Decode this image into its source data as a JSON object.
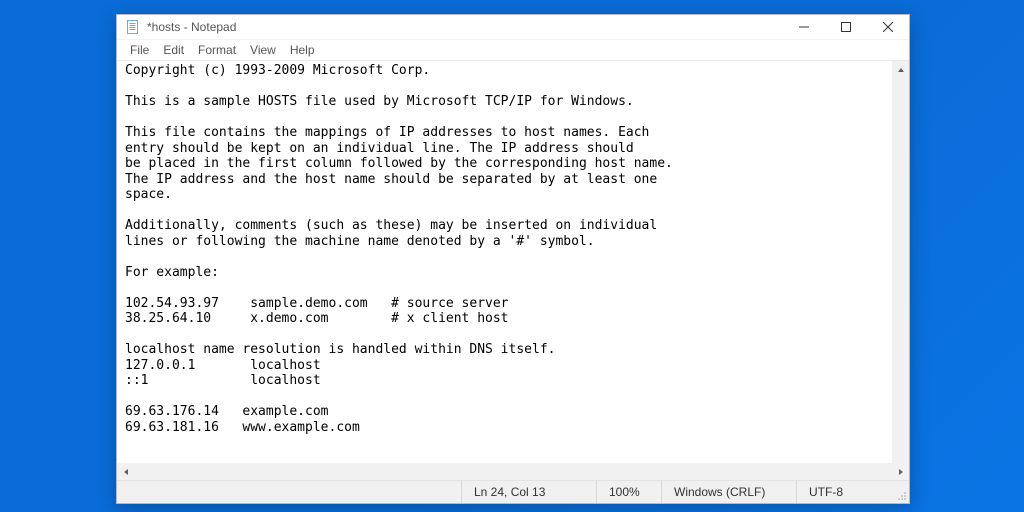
{
  "window": {
    "title": "*hosts - Notepad"
  },
  "menubar": {
    "items": [
      "File",
      "Edit",
      "Format",
      "View",
      "Help"
    ]
  },
  "editor": {
    "content": "Copyright (c) 1993-2009 Microsoft Corp.\n\nThis is a sample HOSTS file used by Microsoft TCP/IP for Windows.\n\nThis file contains the mappings of IP addresses to host names. Each\nentry should be kept on an individual line. The IP address should\nbe placed in the first column followed by the corresponding host name.\nThe IP address and the host name should be separated by at least one\nspace.\n\nAdditionally, comments (such as these) may be inserted on individual\nlines or following the machine name denoted by a '#' symbol.\n\nFor example:\n\n102.54.93.97    sample.demo.com   # source server\n38.25.64.10     x.demo.com        # x client host\n\nlocalhost name resolution is handled within DNS itself.\n127.0.0.1       localhost\n::1             localhost\n\n69.63.176.14   example.com\n69.63.181.16   www.example.com"
  },
  "statusbar": {
    "position": "Ln 24, Col 13",
    "zoom": "100%",
    "line_ending": "Windows (CRLF)",
    "encoding": "UTF-8"
  }
}
